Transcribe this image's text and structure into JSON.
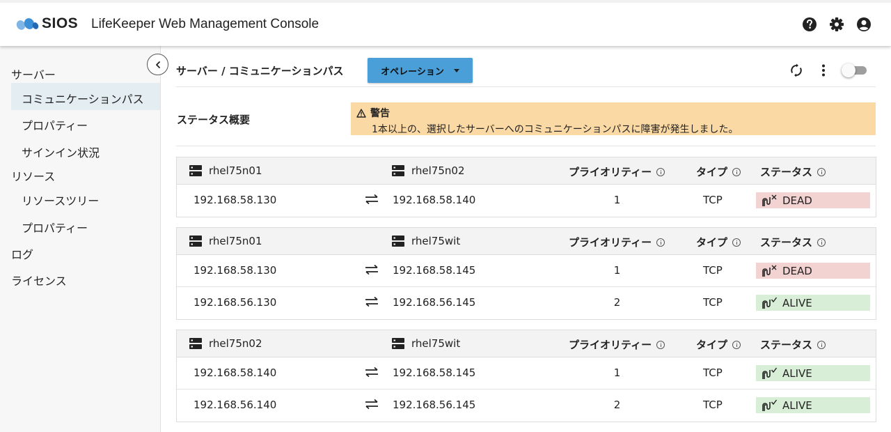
{
  "header": {
    "logo_text": "SIOS",
    "title": "LifeKeeper Web Management Console",
    "icons": [
      "help-icon",
      "settings-icon",
      "account-icon"
    ]
  },
  "sidebar": {
    "items": [
      {
        "label": "サーバー",
        "level": 0
      },
      {
        "label": "コミュニケーションパス",
        "level": 1,
        "active": true
      },
      {
        "label": "プロパティー",
        "level": 1
      },
      {
        "label": "サインイン状況",
        "level": 1
      },
      {
        "label": "リソース",
        "level": 0
      },
      {
        "label": "リソースツリー",
        "level": 1
      },
      {
        "label": "プロパティー",
        "level": 1
      },
      {
        "label": "ログ",
        "level": 0
      },
      {
        "label": "ライセンス",
        "level": 0
      }
    ]
  },
  "toolbar": {
    "breadcrumb": "サーバー / コミュニケーションパス",
    "operations_label": "オペレーション",
    "toggle_on": false
  },
  "status": {
    "title": "ステータス概要",
    "warning_title": "警告",
    "warning_message": "1本以上の、選択したサーバーへのコミュニケーションパスに障害が発生しました。"
  },
  "columns": {
    "priority": "プライオリティー",
    "type": "タイプ",
    "status": "ステータス"
  },
  "colors": {
    "accent": "#4a9fd8",
    "warning_bg": "#fbd9a4",
    "dead_bg": "#f3d2d2",
    "alive_bg": "#d8eed6"
  },
  "groups": [
    {
      "server_a": "rhel75n01",
      "server_b": "rhel75n02",
      "paths": [
        {
          "ip_a": "192.168.58.130",
          "ip_b": "192.168.58.140",
          "priority": "1",
          "type": "TCP",
          "status": "DEAD"
        }
      ]
    },
    {
      "server_a": "rhel75n01",
      "server_b": "rhel75wit",
      "paths": [
        {
          "ip_a": "192.168.58.130",
          "ip_b": "192.168.58.145",
          "priority": "1",
          "type": "TCP",
          "status": "DEAD"
        },
        {
          "ip_a": "192.168.56.130",
          "ip_b": "192.168.56.145",
          "priority": "2",
          "type": "TCP",
          "status": "ALIVE"
        }
      ]
    },
    {
      "server_a": "rhel75n02",
      "server_b": "rhel75wit",
      "paths": [
        {
          "ip_a": "192.168.58.140",
          "ip_b": "192.168.58.145",
          "priority": "1",
          "type": "TCP",
          "status": "ALIVE"
        },
        {
          "ip_a": "192.168.56.140",
          "ip_b": "192.168.56.145",
          "priority": "2",
          "type": "TCP",
          "status": "ALIVE"
        }
      ]
    }
  ]
}
